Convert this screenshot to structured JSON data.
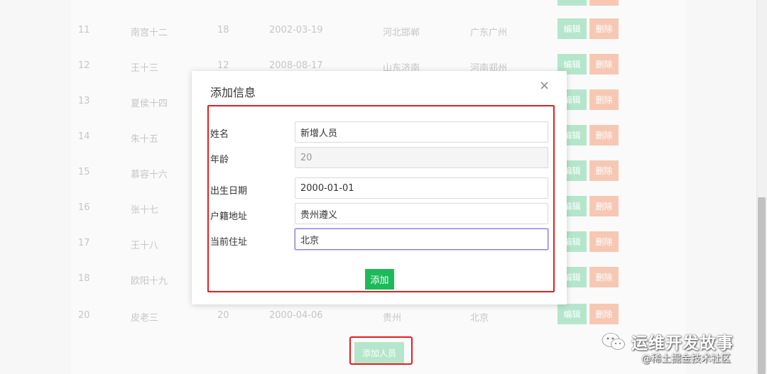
{
  "table": {
    "rows": [
      {
        "id": "11",
        "name": "南宫十二",
        "age": "18",
        "date": "2002-03-19",
        "birthplace": "河北邯郸",
        "address": "广东广州"
      },
      {
        "id": "12",
        "name": "王十三",
        "age": "12",
        "date": "2008-08-17",
        "birthplace": "山东济南",
        "address": "河南郑州"
      },
      {
        "id": "13",
        "name": "夏侯十四",
        "age": "",
        "date": "",
        "birthplace": "",
        "address": ""
      },
      {
        "id": "14",
        "name": "朱十五",
        "age": "",
        "date": "",
        "birthplace": "",
        "address": ""
      },
      {
        "id": "15",
        "name": "慕容十六",
        "age": "",
        "date": "",
        "birthplace": "",
        "address": ""
      },
      {
        "id": "16",
        "name": "张十七",
        "age": "",
        "date": "",
        "birthplace": "",
        "address": ""
      },
      {
        "id": "17",
        "name": "王十八",
        "age": "",
        "date": "",
        "birthplace": "",
        "address": ""
      },
      {
        "id": "18",
        "name": "欧阳十九",
        "age": "",
        "date": "",
        "birthplace": "",
        "address": ""
      },
      {
        "id": "20",
        "name": "皮老三",
        "age": "20",
        "date": "2000-04-06",
        "birthplace": "贵州",
        "address": "北京"
      }
    ],
    "edit_label": "编辑",
    "delete_label": "删除"
  },
  "add_person_button": "添加人员",
  "modal": {
    "title": "添加信息",
    "close_symbol": "×",
    "fields": {
      "name_label": "姓名",
      "name_value": "新增人员",
      "age_label": "年龄",
      "age_value": "20",
      "birth_label": "出生日期",
      "birth_value": "2000-01-01",
      "hukou_label": "户籍地址",
      "hukou_value": "贵州遵义",
      "current_label": "当前住址",
      "current_value": "北京"
    },
    "submit_label": "添加"
  },
  "watermark": {
    "title": "运维开发故事",
    "subtitle": "@稀土掘金技术社区"
  },
  "colors": {
    "primary_green": "#1dba5a",
    "edit_faded": "#b5e6cc",
    "delete_faded": "#f6c8b4",
    "highlight_red": "#e02020"
  }
}
